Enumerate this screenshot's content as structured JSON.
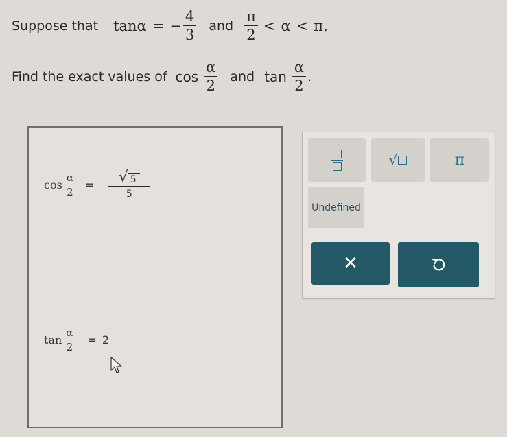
{
  "problem": {
    "intro": "Suppose that",
    "given_fn": "tan",
    "alpha": "α",
    "equals": "=",
    "neg_sign": "−",
    "given_num": "4",
    "given_den": "3",
    "and1": "and",
    "range_num": "π",
    "range_den": "2",
    "lt1": "<",
    "lt2": "<",
    "pi_end": "π.",
    "question": "Find the exact values of",
    "q_fn1": "cos",
    "and2": "and",
    "q_fn2": "tan",
    "half_den": "2",
    "period": "."
  },
  "answers": {
    "cos": {
      "fn": "cos",
      "arg_num": "α",
      "arg_den": "2",
      "equals": "=",
      "radicand": "5",
      "den": "5"
    },
    "tan": {
      "fn": "tan",
      "arg_num": "α",
      "arg_den": "2",
      "equals": "=",
      "value": "2"
    }
  },
  "palette": {
    "fraction_icon": "fraction-template-icon",
    "sqrt_icon": "square-root-template-icon",
    "pi_symbol": "π",
    "undefined_label": "Undefined",
    "clear_symbol": "✕",
    "undo_icon": "undo-icon"
  },
  "colors": {
    "background": "#dedbd6",
    "dark_button": "#245a67",
    "template_box": "#2f6b83"
  }
}
